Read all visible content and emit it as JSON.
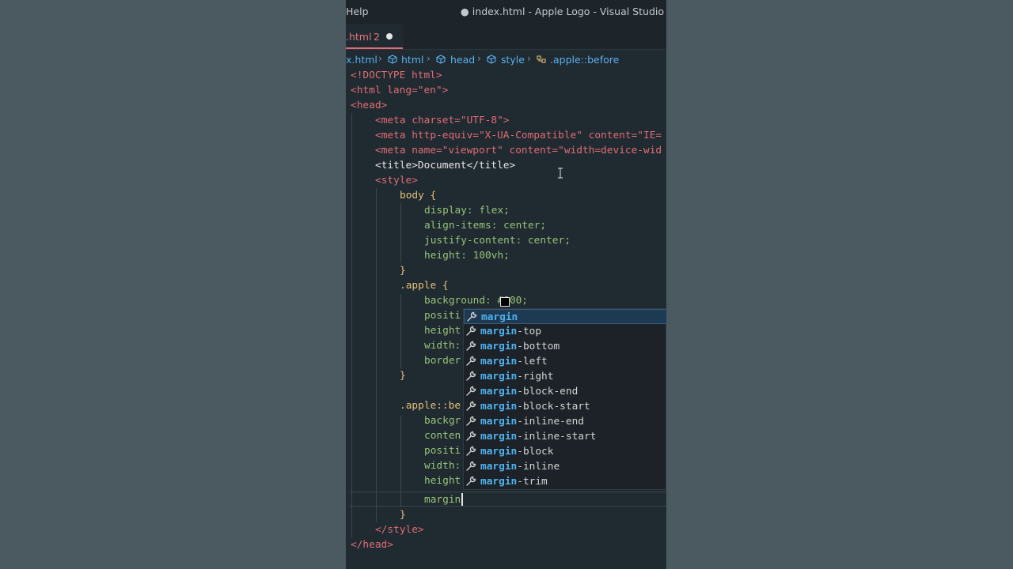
{
  "titlebar": {
    "menu": "Help",
    "window_title": "● index.html - Apple Logo - Visual Studio"
  },
  "tab": {
    "name": ".html",
    "problems": "2"
  },
  "breadcrumb": [
    "x.html",
    "html",
    "head",
    "style",
    ".apple::before"
  ],
  "code_lines": [
    "<!DOCTYPE html>",
    "<html lang=\"en\">",
    "<head>",
    "<meta charset=\"UTF-8\">",
    "<meta http-equiv=\"X-UA-Compatible\" content=\"IE=",
    "<meta name=\"viewport\" content=\"width=device-wid",
    "<title>Document</title>",
    "<style>",
    "body {",
    "display: flex;",
    "align-items: center;",
    "justify-content: center;",
    "height: 100vh;",
    "}",
    ".apple {",
    "background: #000;",
    "positi",
    "height",
    "width:",
    "border",
    "}",
    "",
    ".apple::be",
    "backgr",
    "conten",
    "positi",
    "width:",
    "height",
    "margin",
    "}",
    "</style>",
    "</head>"
  ],
  "suggestions": {
    "typed": "margin",
    "items": [
      "margin",
      "margin-top",
      "margin-bottom",
      "margin-left",
      "margin-right",
      "margin-block-end",
      "margin-block-start",
      "margin-inline-end",
      "margin-inline-start",
      "margin-block",
      "margin-inline",
      "margin-trim"
    ]
  },
  "colors": {
    "selected": "#1e3a52",
    "match": "#4fb2f0",
    "swatch": "#000000"
  }
}
